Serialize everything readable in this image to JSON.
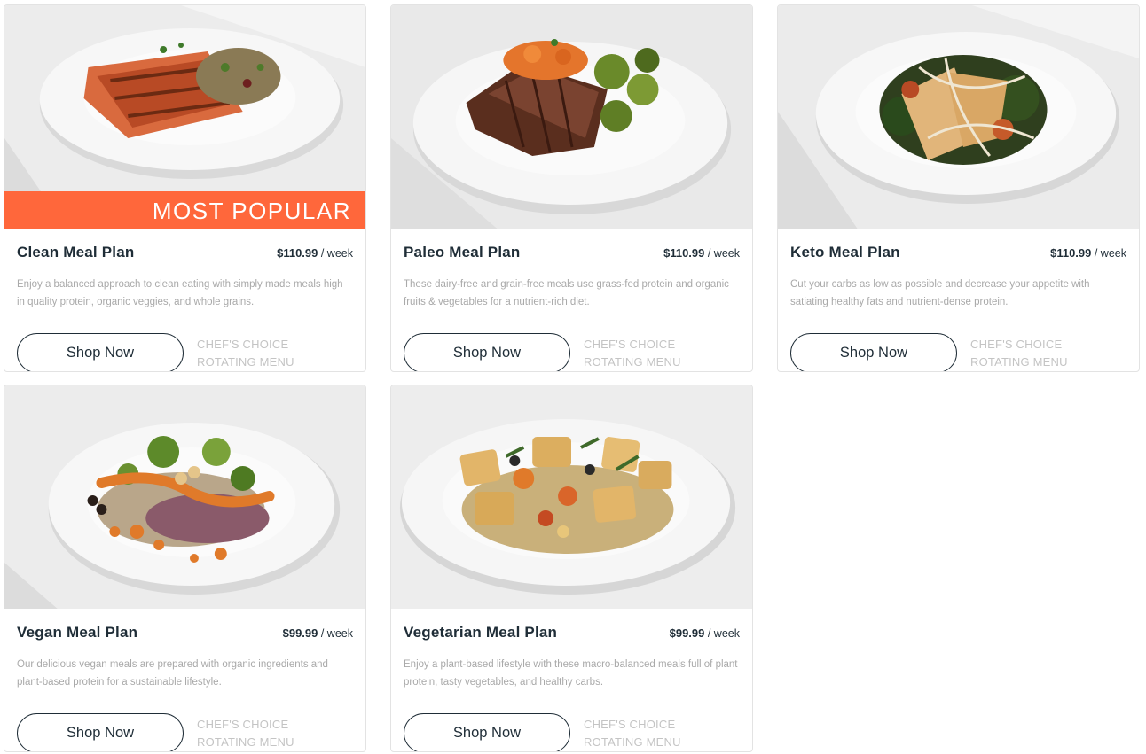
{
  "plans": [
    {
      "title": "Clean Meal Plan",
      "price": "$110.99",
      "period": "/ week",
      "description": "Enjoy a balanced approach to clean eating with simply made meals high in quality protein, organic veggies, and whole grains.",
      "button": "Shop Now",
      "note": "CHEF'S CHOICE ROTATING MENU",
      "badge": "MOST POPULAR"
    },
    {
      "title": "Paleo Meal Plan",
      "price": "$110.99",
      "period": "/ week",
      "description": "These dairy-free and grain-free meals use grass-fed protein and organic fruits & vegetables for a nutrient-rich diet.",
      "button": "Shop Now",
      "note": "CHEF'S CHOICE ROTATING MENU"
    },
    {
      "title": "Keto Meal Plan",
      "price": "$110.99",
      "period": "/ week",
      "description": "Cut your carbs as low as possible and decrease your appetite with satiating healthy fats and nutrient-dense protein.",
      "button": "Shop Now",
      "note": "CHEF'S CHOICE ROTATING MENU"
    },
    {
      "title": "Vegan Meal Plan",
      "price": "$99.99",
      "period": "/ week",
      "description": "Our delicious vegan meals are prepared with organic ingredients and plant-based protein for a sustainable lifestyle.",
      "button": "Shop Now",
      "note": "CHEF'S CHOICE ROTATING MENU"
    },
    {
      "title": "Vegetarian Meal Plan",
      "price": "$99.99",
      "period": "/ week",
      "description": "Enjoy a plant-based lifestyle with these macro-balanced meals full of plant protein, tasty vegetables, and healthy carbs.",
      "button": "Shop Now",
      "note": "CHEF'S CHOICE ROTATING MENU"
    }
  ],
  "colors": {
    "badge": "#ff673b",
    "text": "#1f2d37",
    "muted": "#a9a9a9"
  }
}
